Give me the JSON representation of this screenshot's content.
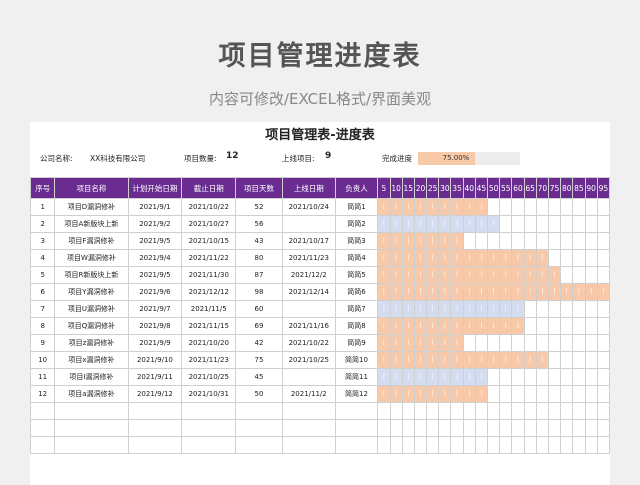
{
  "header": {
    "title": "项目管理进度表",
    "subtitle": "内容可修改/EXCEL格式/界面美观"
  },
  "sheet": {
    "title": "项目管理表-进度表",
    "company_label": "公司名称:",
    "company_value": "XX科技有限公司",
    "count_label": "项目数量:",
    "count_value": "12",
    "online_label": "上线项目:",
    "online_value": "9",
    "progress_label": "完成进度",
    "progress_value": "75.00%",
    "progress_fraction": 0.75
  },
  "table": {
    "headers": [
      "序号",
      "项目名称",
      "计划开始日期",
      "截止日期",
      "项目天数",
      "上线日期",
      "负责人"
    ],
    "day_ticks": [
      "5",
      "10",
      "15",
      "20",
      "25",
      "30",
      "35",
      "40",
      "45",
      "50",
      "55",
      "60",
      "65",
      "70",
      "75",
      "80",
      "85",
      "90",
      "95"
    ],
    "rows": [
      {
        "no": "1",
        "name": "项目D漏洞修补",
        "start": "2021/9/1",
        "deadline": "2021/10/22",
        "days": "52",
        "online": "2021/10/24",
        "owner": "简简1",
        "cells": 9,
        "blue": false
      },
      {
        "no": "2",
        "name": "项目A新版块上新",
        "start": "2021/9/2",
        "deadline": "2021/10/27",
        "days": "56",
        "online": "",
        "owner": "简简2",
        "cells": 10,
        "blue": true
      },
      {
        "no": "3",
        "name": "项目F漏洞修补",
        "start": "2021/9/5",
        "deadline": "2021/10/15",
        "days": "43",
        "online": "2021/10/17",
        "owner": "简简3",
        "cells": 7,
        "blue": false
      },
      {
        "no": "4",
        "name": "项目W漏洞修补",
        "start": "2021/9/4",
        "deadline": "2021/11/22",
        "days": "80",
        "online": "2021/11/23",
        "owner": "简简4",
        "cells": 14,
        "blue": false
      },
      {
        "no": "5",
        "name": "项目R新版块上新",
        "start": "2021/9/5",
        "deadline": "2021/11/30",
        "days": "87",
        "online": "2021/12/2",
        "owner": "简简5",
        "cells": 15,
        "blue": false
      },
      {
        "no": "6",
        "name": "项目Y漏洞修补",
        "start": "2021/9/6",
        "deadline": "2021/12/12",
        "days": "98",
        "online": "2021/12/14",
        "owner": "简简6",
        "cells": 19,
        "blue": false
      },
      {
        "no": "7",
        "name": "项目U漏洞修补",
        "start": "2021/9/7",
        "deadline": "2021/11/5",
        "days": "60",
        "online": "",
        "owner": "简简7",
        "cells": 12,
        "blue": true
      },
      {
        "no": "8",
        "name": "项目Q漏洞修补",
        "start": "2021/9/8",
        "deadline": "2021/11/15",
        "days": "69",
        "online": "2021/11/16",
        "owner": "简简8",
        "cells": 12,
        "blue": false
      },
      {
        "no": "9",
        "name": "项目z漏洞修补",
        "start": "2021/9/9",
        "deadline": "2021/10/20",
        "days": "42",
        "online": "2021/10/22",
        "owner": "简简9",
        "cells": 7,
        "blue": false
      },
      {
        "no": "10",
        "name": "项目x漏洞修补",
        "start": "2021/9/10",
        "deadline": "2021/11/23",
        "days": "75",
        "online": "2021/10/25",
        "owner": "简简10",
        "cells": 14,
        "blue": false
      },
      {
        "no": "11",
        "name": "项目I漏洞修补",
        "start": "2021/9/11",
        "deadline": "2021/10/25",
        "days": "45",
        "online": "",
        "owner": "简简11",
        "cells": 9,
        "blue": true
      },
      {
        "no": "12",
        "name": "项目a漏洞修补",
        "start": "2021/9/12",
        "deadline": "2021/10/31",
        "days": "50",
        "online": "2021/11/2",
        "owner": "简简12",
        "cells": 9,
        "blue": false
      }
    ],
    "empty_rows": 3
  },
  "colors": {
    "header_purple": "#6a2c91",
    "bar_orange": "#f8c9a8",
    "bar_blue": "#d4dcf0"
  },
  "icons": []
}
